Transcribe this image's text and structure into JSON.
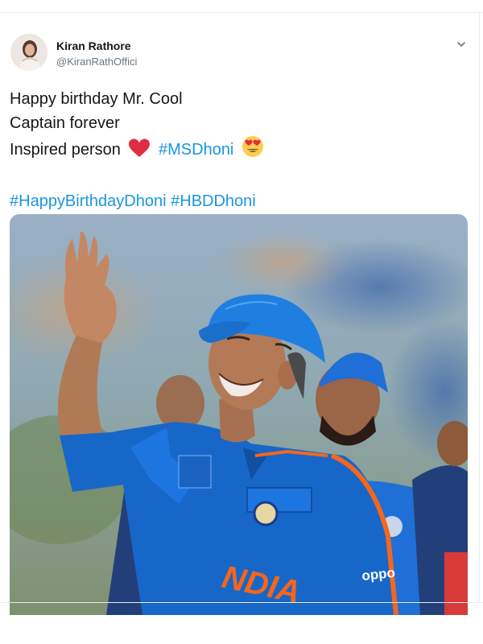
{
  "tweet": {
    "author": {
      "display_name": "Kiran Rathore",
      "handle": "@KiranRathOffici"
    },
    "text": {
      "line1": "Happy birthday Mr. Cool",
      "line2": "Captain forever",
      "line3_prefix": "Inspired person",
      "line3_hashtag": "#MSDhoni",
      "hashtags": [
        "#HappyBirthdayDhoni",
        "#HBDDhoni"
      ]
    },
    "icons": [
      "red-heart-icon",
      "heart-eyes-emoji-icon",
      "chevron-down-icon"
    ],
    "media": {
      "jersey_text": "NDIA",
      "sponsor_text": "oppo"
    }
  },
  "colors": {
    "hashtag": "#1b95e0",
    "text": "#14171a",
    "muted": "#657786",
    "heart": "#e0245e",
    "jersey_blue": "#1767c9",
    "cap_blue": "#1f7fe0",
    "jersey_orange": "#f5661d"
  }
}
